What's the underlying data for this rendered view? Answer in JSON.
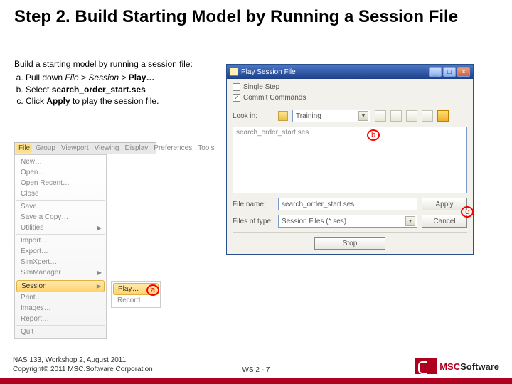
{
  "title": "Step 2. Build Starting Model by Running a Session File",
  "body": {
    "intro": "Build a starting model by running a session file:",
    "steps": [
      {
        "pre": "Pull down ",
        "i1": "File",
        "mid": " > ",
        "i2": "Session",
        "mid2": " > ",
        "b": "Play…"
      },
      {
        "pre": "Select ",
        "b": "search_order_start.ses"
      },
      {
        "pre": "Click ",
        "b": "Apply",
        "post": " to play the session file."
      }
    ]
  },
  "menubar": [
    "File",
    "Group",
    "Viewport",
    "Viewing",
    "Display",
    "Preferences",
    "Tools"
  ],
  "filemenu": {
    "items": [
      {
        "label": "New…"
      },
      {
        "label": "Open…"
      },
      {
        "label": "Open Recent…"
      },
      {
        "label": "Close",
        "sep": true
      },
      {
        "label": "Save"
      },
      {
        "label": "Save a Copy…"
      },
      {
        "label": "Utilities",
        "sub": true,
        "sep": true
      },
      {
        "label": "Import…"
      },
      {
        "label": "Export…"
      },
      {
        "label": "SimXpert…"
      },
      {
        "label": "SimManager",
        "sub": true,
        "sep": true
      },
      {
        "label": "Session",
        "sub": true,
        "hl": true
      },
      {
        "label": "Print…"
      },
      {
        "label": "Images…"
      },
      {
        "label": "Report…",
        "sep": true
      },
      {
        "label": "Quit"
      }
    ],
    "submenu": [
      {
        "label": "Play…",
        "hl": true
      },
      {
        "label": "Record…"
      }
    ]
  },
  "dialog": {
    "title": "Play Session File",
    "single_step": "Single Step",
    "commit_commands": "Commit Commands",
    "look_in_label": "Look in:",
    "look_in_value": "Training",
    "list_item": "search_order_start.ses",
    "filename_label": "File name:",
    "filename_value": "search_order_start.ses",
    "filetype_label": "Files of type:",
    "filetype_value": "Session Files (*.ses)",
    "apply": "Apply",
    "cancel": "Cancel",
    "stop": "Stop"
  },
  "callouts": {
    "a": "a",
    "b": "b",
    "c": "c"
  },
  "footer": {
    "line1": "NAS 133, Workshop 2, August 2011",
    "line2": "Copyright© 2011 MSC.Software Corporation",
    "center": "WS 2 - 7",
    "logo1": "MSC",
    "logo2": "Software"
  }
}
